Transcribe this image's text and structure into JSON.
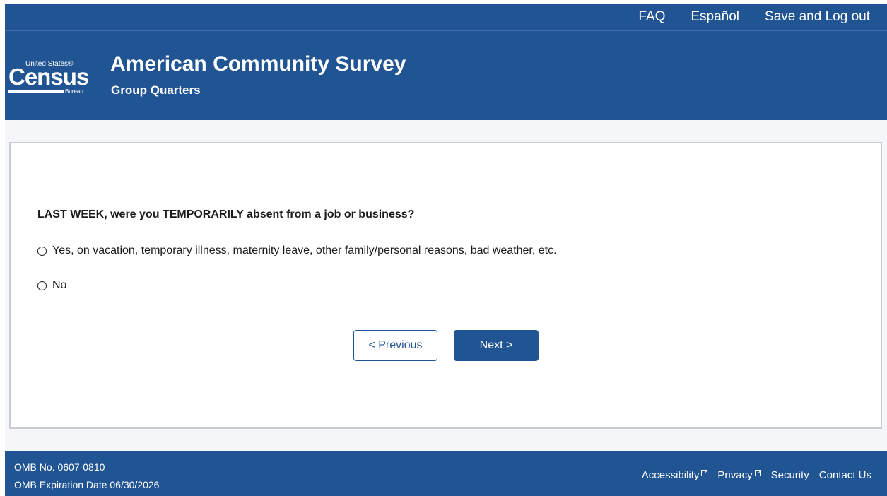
{
  "top_nav": {
    "faq": "FAQ",
    "espanol": "Español",
    "save_logout": "Save and Log out"
  },
  "logo": {
    "united_states": "United States®",
    "census": "Census",
    "bureau": "Bureau"
  },
  "header": {
    "title": "American Community Survey",
    "subtitle": "Group Quarters"
  },
  "question": {
    "text": "LAST WEEK, were you TEMPORARILY absent from a job or business?",
    "options": [
      {
        "label": "Yes, on vacation, temporary illness, maternity leave, other family/personal reasons, bad weather, etc."
      },
      {
        "label": "No"
      }
    ]
  },
  "buttons": {
    "previous": "< Previous",
    "next": "Next >"
  },
  "footer": {
    "omb_number": "OMB No. 0607-0810",
    "omb_expiration": "OMB Expiration Date 06/30/2026",
    "links": {
      "accessibility": "Accessibility",
      "privacy": "Privacy",
      "security": "Security",
      "contact": "Contact Us"
    }
  },
  "colors": {
    "brand_blue": "#205493",
    "card_border": "#c7ccd3",
    "page_background": "#f4f6f9"
  },
  "icons": {
    "radio": "radio-unselected-icon",
    "external_link": "external-link-icon"
  }
}
